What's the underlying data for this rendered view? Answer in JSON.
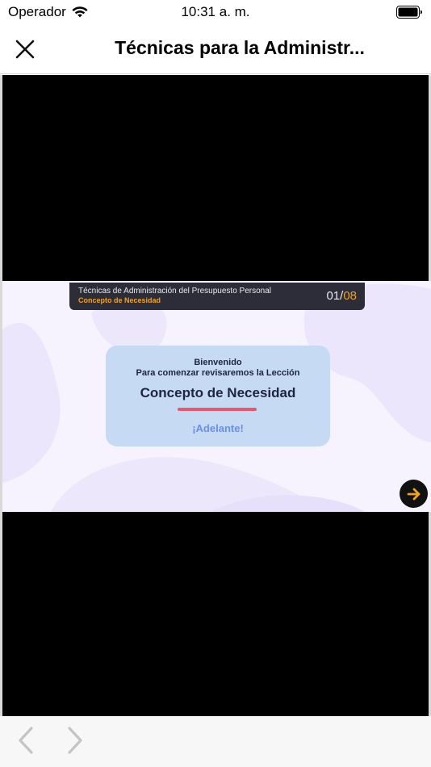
{
  "status_bar": {
    "carrier": "Operador",
    "time": "10:31 a. m.",
    "icons": [
      "wifi-icon",
      "battery-icon"
    ]
  },
  "nav": {
    "title": "Técnicas para la Administr...",
    "close_icon": "close-icon"
  },
  "slide": {
    "course": "Técnicas de Administración del Presupuesto Personal",
    "lesson": "Concepto de Necesidad",
    "counter_current": "01",
    "counter_separator": "/",
    "counter_total": "08",
    "card": {
      "welcome": "Bienvenido",
      "intro": "Para comenzar revisaremos la Lección",
      "title": "Concepto de Necesidad",
      "link": "¡Adelante!"
    },
    "next_icon": "arrow-right-icon"
  },
  "toolbar": {
    "back_icon": "chevron-left-icon",
    "forward_icon": "chevron-right-icon"
  },
  "colors": {
    "accent_orange": "#f0a020",
    "card_blue": "#c6daf4",
    "underline_pink": "#e25a6e",
    "link_blue": "#6b8fe6"
  }
}
